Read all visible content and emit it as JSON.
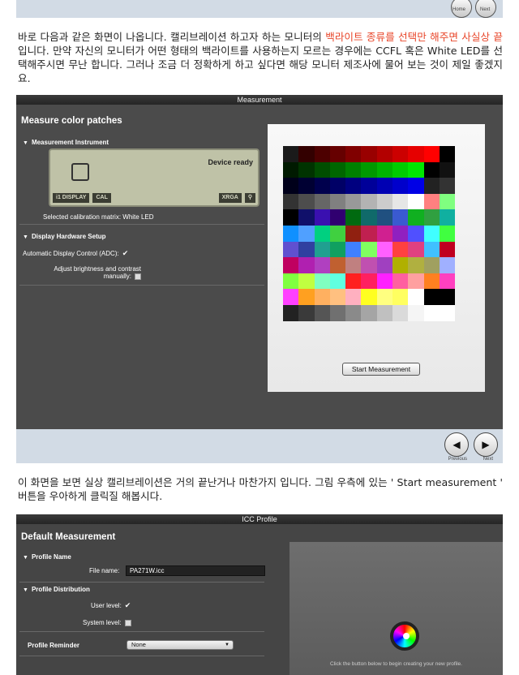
{
  "top_nav": {
    "home_label": "Home",
    "next_label": "Next"
  },
  "para1": {
    "text_a": "바로 다음과 같은 화면이 나옵니다. 캘리브레이션 하고자 하는 모니터의 ",
    "highlight": "백라이트 종류를 선택만 해주면 사실상 끝",
    "text_b": " 입니다. 만약 자신의 모니터가 어떤 형태의 백라이트를 사용하는지 모르는 경우에는 CCFL 혹은 White LED를 선택해주시면 무난 합니다. 그러나 조금 더 정확하게 하고 싶다면 해당 모니터 제조사에 물어 보는 것이 제일 좋겠지요."
  },
  "measurement_window": {
    "title": "Measurement",
    "heading": "Measure color patches",
    "instrument_section": "Measurement Instrument",
    "device_status": "Device ready",
    "lcd_tags": [
      "i1 DISPLAY",
      "CAL",
      "XRGA"
    ],
    "matrix_label": "Selected calibration matrix: White LED",
    "hardware_section": "Display Hardware Setup",
    "adc_label": "Automatic Display Control (ADC):",
    "brightness_label_1": "Adjust brightness and contrast",
    "brightness_label_2": "manually:",
    "start_button": "Start Measurement",
    "patch_colors": [
      "#1a1a1a",
      "#330000",
      "#4d0000",
      "#660000",
      "#800000",
      "#990000",
      "#b30000",
      "#cc0000",
      "#e60000",
      "#ff0000",
      "#000000",
      "#001a00",
      "#003300",
      "#004d00",
      "#006600",
      "#008000",
      "#009900",
      "#00b300",
      "#00cc00",
      "#00e600",
      "#000000",
      "#111111",
      "#00001a",
      "#000033",
      "#00004d",
      "#000066",
      "#000080",
      "#000099",
      "#0000b3",
      "#0000cc",
      "#0000e6",
      "#222222",
      "#333333",
      "#333333",
      "#4d4d4d",
      "#666666",
      "#808080",
      "#999999",
      "#b3b3b3",
      "#cccccc",
      "#e6e6e6",
      "#ffffff",
      "#ff8080",
      "#80ff80",
      "#000000",
      "#10106a",
      "#3a10b0",
      "#300070",
      "#006a10",
      "#106a6a",
      "#205080",
      "#3a5ad0",
      "#10b020",
      "#30a040",
      "#10b0a0",
      "#1090ff",
      "#50a0ff",
      "#00d080",
      "#40d040",
      "#902010",
      "#c02050",
      "#d02090",
      "#9020c0",
      "#5050ff",
      "#40ffff",
      "#40ff40",
      "#6050d0",
      "#3040a0",
      "#20a090",
      "#10a060",
      "#4080ff",
      "#80ff60",
      "#ff60ff",
      "#ff4040",
      "#e04080",
      "#40c0ff",
      "#c00020",
      "#c00060",
      "#b020b0",
      "#b040c0",
      "#c06030",
      "#c08080",
      "#c050b0",
      "#a040c0",
      "#b0b000",
      "#b0b040",
      "#a0a060",
      "#a0b0ff",
      "#80ff40",
      "#c0ff40",
      "#80ffc0",
      "#60ffe0",
      "#ff2020",
      "#ff2060",
      "#ff20ff",
      "#ff60a0",
      "#ffa0a0",
      "#ff8020",
      "#ff40c0",
      "#ff40ff",
      "#ffa020",
      "#ffb060",
      "#ffc080",
      "#ffb0c0",
      "#ffff20",
      "#ffff80",
      "#ffff60",
      "#ffffff",
      "#000000",
      "#000000",
      "#222222",
      "#3a3a3a",
      "#555555",
      "#707070",
      "#8a8a8a",
      "#a5a5a5",
      "#c0c0c0",
      "#dadada",
      "#f5f5f5",
      "#ffffff",
      "#ffffff"
    ]
  },
  "bottom_nav": {
    "previous_label": "Previous",
    "next_label": "Next"
  },
  "para2": {
    "text": "이 화면을 보면 실상 캘리브레이션은 거의 끝난거나 마찬가지 입니다. 그림 우측에 있는 ' Start measurement ' 버튼을 우아하게 클릭질 해봅시다."
  },
  "icc_window": {
    "title": "ICC Profile",
    "heading": "Default Measurement",
    "profile_name_section": "Profile Name",
    "file_name_label": "File name:",
    "file_name_value": "PA271W.icc",
    "distribution_section": "Profile Distribution",
    "user_level_label": "User level:",
    "system_level_label": "System level:",
    "reminder_label": "Profile Reminder",
    "reminder_value": "None",
    "hint_text": "Click the button below to begin creating your new profile."
  }
}
